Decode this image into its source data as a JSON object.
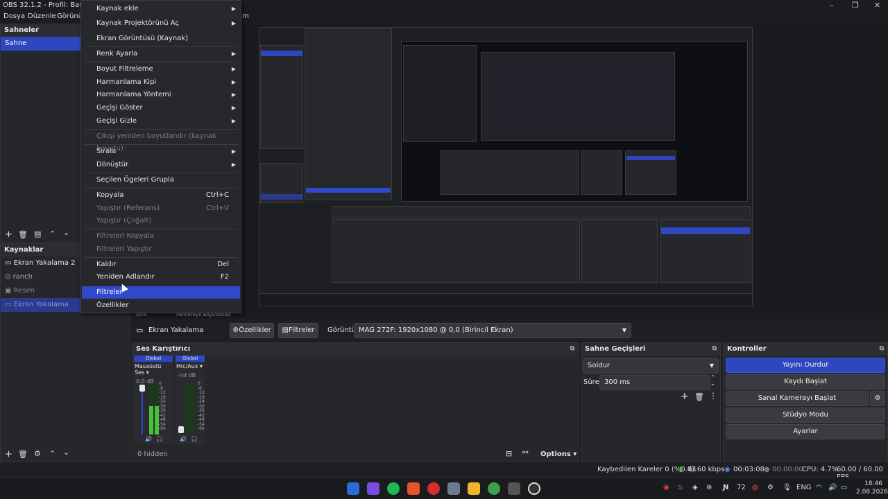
{
  "window": {
    "title": "OBS 32.1.2 - Profil: Başlıksız",
    "min": "–",
    "max": "❐",
    "close": "✕"
  },
  "menubar": {
    "file": "Dosya",
    "edit": "Düzenle",
    "view": "Görünü",
    "tail": "m"
  },
  "scenes": {
    "header": "Sahneler",
    "items": [
      "Sahne"
    ]
  },
  "sources": {
    "header": "Kaynaklar",
    "items": [
      {
        "label": "Ekran Yakalama 2",
        "icon": "monitor-icon"
      },
      {
        "label": "ranch",
        "icon": "gamepad-icon"
      },
      {
        "label": "Resim",
        "icon": "image-icon"
      },
      {
        "label": "Ekran Yakalama",
        "icon": "monitor-icon"
      }
    ]
  },
  "context_menu": {
    "items": [
      {
        "label": "Kaynak ekle",
        "arrow": true
      },
      {
        "label": "Kaynak Projektörünü Aç",
        "arrow": true
      },
      {
        "label": "Ekran Görüntüsü (Kaynak)"
      },
      {
        "label": "Renk Ayarla",
        "arrow": true
      },
      {
        "label": "Boyut Filtreleme",
        "arrow": true
      },
      {
        "label": "Harmanlama Kipi",
        "arrow": true
      },
      {
        "label": "Harmanlama Yöntemi",
        "arrow": true
      },
      {
        "label": "Geçişi Göster",
        "arrow": true
      },
      {
        "label": "Geçişi Gizle",
        "arrow": true
      },
      {
        "label": "Çıkışı yeniden boyutlandır (kaynak boyutu)",
        "disabled": true
      },
      {
        "label": "Sırala",
        "arrow": true
      },
      {
        "label": "Dönüştür",
        "arrow": true
      },
      {
        "label": "Seçilen Ögeleri Grupla"
      },
      {
        "label": "Kopyala",
        "shortcut": "Ctrl+C"
      },
      {
        "label": "Yapıştır (Referans)",
        "shortcut": "Ctrl+V",
        "disabled": true
      },
      {
        "label": "Yapıştır (Çoğalt)",
        "disabled": true
      },
      {
        "label": "Filtreleri Kopyala",
        "disabled": true
      },
      {
        "label": "Filtreleri Yapıştır",
        "disabled": true
      },
      {
        "label": "Kaldır",
        "shortcut": "Del"
      },
      {
        "label": "Yeniden Adlandır",
        "shortcut": "F2"
      },
      {
        "label": "Filtreler",
        "highlighted": true
      },
      {
        "label": "Özellikler"
      }
    ]
  },
  "zoom": {
    "value": "55%",
    "mode": "Pencereye Boyutlandır"
  },
  "propbar": {
    "source_name": "Ekran Yakalama",
    "properties": "Özellikler",
    "filters": "Filtreler",
    "display_label": "Görüntü",
    "display_value": "MAG 272F: 1920x1080 @ 0,0 (Birincil Ekran)"
  },
  "mixer": {
    "header": "Ses Karıştırıcı",
    "channels": [
      {
        "group": "Global",
        "name": "Masaüstü Ses",
        "db": "0.0 dB",
        "level": 0.55
      },
      {
        "group": "Global",
        "name": "Mic/Aux",
        "db": "-inf dB",
        "level": 0.0
      }
    ],
    "scale": [
      "0",
      "-6",
      "-12",
      "-18",
      "-24",
      "-30",
      "-36",
      "-42",
      "-48",
      "-54",
      "-60"
    ],
    "hidden": "0 hidden",
    "options": "Options"
  },
  "transitions": {
    "header": "Sahne Geçişleri",
    "type": "Soldur",
    "duration_label": "Süre",
    "duration": "300 ms"
  },
  "controls": {
    "header": "Kontroller",
    "stop_stream": "Yayını Durdur",
    "start_record": "Kaydı Başlat",
    "virtual_cam": "Sanal Kamerayı Başlat",
    "studio": "Stüdyo Modu",
    "settings": "Ayarlar"
  },
  "status": {
    "dropped": "Kaybedilen Kareler 0 (%0.0)",
    "bitrate": "6160 kbps",
    "stream_time": "00:03:08",
    "rec_time": "00:00:00",
    "cpu": "CPU: 4.7%",
    "fps": "60.00 / 60.00 FPS"
  },
  "taskbar": {
    "lang": "ENG",
    "time": "18:46",
    "date": "2.08.2026",
    "temp": "72"
  },
  "colors": {
    "accent": "#2e46c0",
    "meter_green": "#46c23a",
    "bg": "#1e1f23"
  }
}
